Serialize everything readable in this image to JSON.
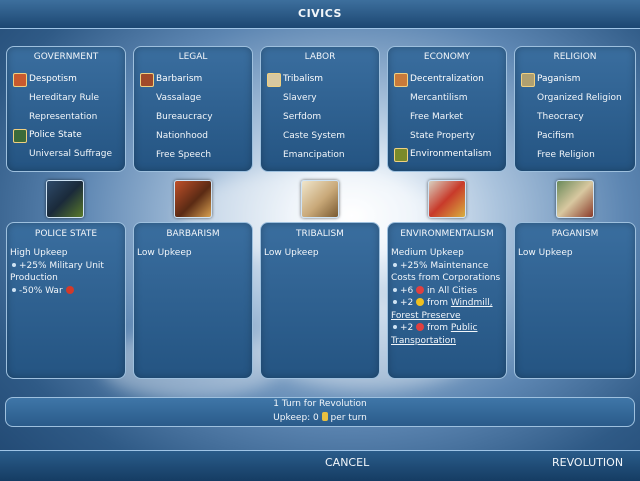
{
  "title": "CIVICS",
  "categories": [
    {
      "name": "GOVERNMENT",
      "civics": [
        "Despotism",
        "Hereditary Rule",
        "Representation",
        "Police State",
        "Universal Suffrage"
      ],
      "selected": [
        0,
        3
      ]
    },
    {
      "name": "LEGAL",
      "civics": [
        "Barbarism",
        "Vassalage",
        "Bureaucracy",
        "Nationhood",
        "Free Speech"
      ],
      "selected": [
        0
      ]
    },
    {
      "name": "LABOR",
      "civics": [
        "Tribalism",
        "Slavery",
        "Serfdom",
        "Caste System",
        "Emancipation"
      ],
      "selected": [
        0
      ]
    },
    {
      "name": "ECONOMY",
      "civics": [
        "Decentralization",
        "Mercantilism",
        "Free Market",
        "State Property",
        "Environmentalism"
      ],
      "selected": [
        0,
        4
      ]
    },
    {
      "name": "RELIGION",
      "civics": [
        "Paganism",
        "Organized Religion",
        "Theocracy",
        "Pacifism",
        "Free Religion"
      ],
      "selected": [
        0
      ]
    }
  ],
  "details": [
    {
      "name": "POLICE STATE",
      "upkeep": "High Upkeep",
      "effects": [
        "+25% Military Unit",
        "Production",
        "-50% War"
      ]
    },
    {
      "name": "BARBARISM",
      "upkeep": "Low Upkeep",
      "effects": []
    },
    {
      "name": "TRIBALISM",
      "upkeep": "Low Upkeep",
      "effects": []
    },
    {
      "name": "ENVIRONMENTALISM",
      "upkeep": "Medium Upkeep",
      "effects": [
        "+25% Maintenance",
        "Costs from Corporations",
        "+6",
        "in All Cities",
        "+2",
        "from",
        "Windmill,",
        "Forest Preserve",
        "+2",
        "from",
        "Public",
        "Transportation"
      ]
    },
    {
      "name": "PAGANISM",
      "upkeep": "Low Upkeep",
      "effects": []
    }
  ],
  "revolution": {
    "turns": "1 Turn for Revolution",
    "upkeep_prefix": "Upkeep: 0",
    "upkeep_suffix": "per turn"
  },
  "buttons": {
    "cancel": "CANCEL",
    "revolution": "REVOLUTION"
  },
  "colors": {
    "panel": "#2f6393",
    "border": "#9ec0de",
    "text": "#f2f6fa"
  }
}
